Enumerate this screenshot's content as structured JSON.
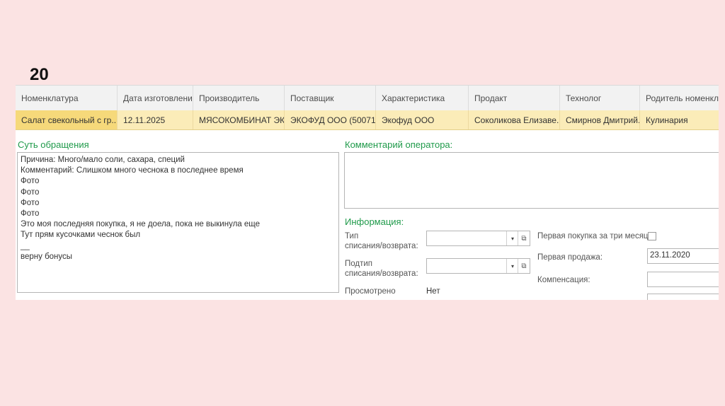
{
  "slide_number": "20",
  "grid": {
    "columns": [
      "Номенклатура",
      "Дата изготовления",
      "Производитель",
      "Поставщик",
      "Характеристика",
      "Продакт",
      "Технолог",
      "Родитель номенклатуры"
    ],
    "row": [
      "Салат свекольный с гр...",
      "12.11.2025",
      "МЯСОКОМБИНАТ ЭК...",
      "ЭКОФУД ООО (50071...",
      "Экофуд ООО",
      "Соколикова Елизаве...",
      "Смирнов Дмитрий...",
      "Кулинария"
    ]
  },
  "essence": {
    "title": "Суть обращения",
    "text": "Причина: Много/мало соли, сахара, специй\nКомментарий: Слишком много чеснока в последнее время\nФото\nФото\nФото\nФото\nЭто моя последняя покупка, я не доела, пока не выкинула еще\nТут прям кусочками чеснок был\n__\nверну бонусы"
  },
  "operator_comment": {
    "title": "Комментарий оператора:",
    "value": ""
  },
  "info": {
    "title": "Информация:",
    "type_label": "Тип\nсписания/возврата:",
    "type_value": "",
    "subtype_label": "Подтип\nсписания/возврата:",
    "subtype_value": "",
    "viewed_label": "Просмотрено",
    "viewed_value": "Нет",
    "first_purchase_label": "Первая покупка за три месяца:",
    "first_purchase_checked": false,
    "first_sale_label": "Первая продажа:",
    "first_sale_value": "23.11.2020",
    "compensation_label": "Компенсация:",
    "compensation_value": ""
  },
  "icons": {
    "dropdown": "▾",
    "open": "⧉"
  }
}
